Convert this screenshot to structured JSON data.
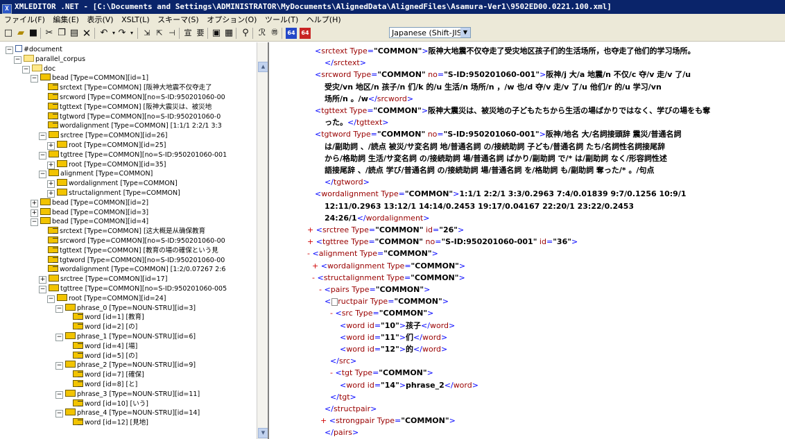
{
  "titlebar": {
    "text": "XMLEDITOR .NET - [C:\\Documents and Settings\\ADMINISTRATOR\\MyDocuments\\AlignedData\\AlignedFiles\\Asamura-Ver1\\9502ED00.0221.100.xml]"
  },
  "menu": [
    "ファイル(F)",
    "編集(E)",
    "表示(V)",
    "XSLT(L)",
    "スキーマ(S)",
    "オプション(O)",
    "ツール(T)",
    "ヘルプ(H)"
  ],
  "toolbar": {
    "encoding": "Japanese (Shift-JIS"
  },
  "tree": [
    {
      "label": "#document",
      "icon": "doc",
      "exp": "−"
    },
    {
      "label": "parallel_corpus",
      "icon": "fd",
      "exp": "−"
    },
    {
      "label": "doc",
      "icon": "fd",
      "exp": "−"
    },
    {
      "label": "bead [Type=COMMON][id=1]",
      "icon": "el",
      "exp": "−"
    },
    {
      "label": "srctext [Type=COMMON] [阪神大地震不仅夺走了",
      "icon": "tx",
      "exp": ""
    },
    {
      "label": "srcword [Type=COMMON][no=S-ID:950201060-00",
      "icon": "tx",
      "exp": ""
    },
    {
      "label": "tgttext [Type=COMMON] [阪神大震災は、被災地",
      "icon": "tx",
      "exp": ""
    },
    {
      "label": "tgtword [Type=COMMON][no=S-ID:950201060-0",
      "icon": "tx",
      "exp": ""
    },
    {
      "label": "wordalignment [Type=COMMON] [1:1/1 2:2/1 3:3",
      "icon": "tx",
      "exp": ""
    },
    {
      "label": "srctree [Type=COMMON][id=26]",
      "icon": "el",
      "exp": "−"
    },
    {
      "label": "root [Type=COMMON][id=25]",
      "icon": "el",
      "exp": "+"
    },
    {
      "label": "tgttree [Type=COMMON][no=S-ID:950201060-001",
      "icon": "el",
      "exp": "−"
    },
    {
      "label": "root [Type=COMMON][id=35]",
      "icon": "el",
      "exp": "+"
    },
    {
      "label": "alignment [Type=COMMON]",
      "icon": "el",
      "exp": "−"
    },
    {
      "label": "wordalignment [Type=COMMON]",
      "icon": "el",
      "exp": "+"
    },
    {
      "label": "structalignment [Type=COMMON]",
      "icon": "el",
      "exp": "+"
    },
    {
      "label": "bead [Type=COMMON][id=2]",
      "icon": "el",
      "exp": "+"
    },
    {
      "label": "bead [Type=COMMON][id=3]",
      "icon": "el",
      "exp": "+"
    },
    {
      "label": "bead [Type=COMMON][id=4]",
      "icon": "el",
      "exp": "−"
    },
    {
      "label": "srctext [Type=COMMON] [这大概是从确保教育",
      "icon": "tx",
      "exp": ""
    },
    {
      "label": "srcword [Type=COMMON][no=S-ID:950201060-00",
      "icon": "tx",
      "exp": ""
    },
    {
      "label": "tgttext [Type=COMMON] [教育の場の確保という見",
      "icon": "tx",
      "exp": ""
    },
    {
      "label": "tgtword [Type=COMMON][no=S-ID:950201060-00",
      "icon": "tx",
      "exp": ""
    },
    {
      "label": "wordalignment [Type=COMMON] [1:2/0.07267 2:6",
      "icon": "tx",
      "exp": ""
    },
    {
      "label": "srctree [Type=COMMON][id=17]",
      "icon": "el",
      "exp": "+"
    },
    {
      "label": "tgttree [Type=COMMON][no=S-ID:950201060-005",
      "icon": "el",
      "exp": "−"
    },
    {
      "label": "root [Type=COMMON][id=24]",
      "icon": "el",
      "exp": "−"
    },
    {
      "label": "phrase_0 [Type=NOUN-STRU][id=3]",
      "icon": "el",
      "exp": "−"
    },
    {
      "label": "word [id=1] [教育]",
      "icon": "tx",
      "exp": ""
    },
    {
      "label": "word [id=2] [の]",
      "icon": "tx",
      "exp": ""
    },
    {
      "label": "phrase_1 [Type=NOUN-STRU][id=6]",
      "icon": "el",
      "exp": "−"
    },
    {
      "label": "word [id=4] [場]",
      "icon": "tx",
      "exp": ""
    },
    {
      "label": "word [id=5] [の]",
      "icon": "tx",
      "exp": ""
    },
    {
      "label": "phrase_2 [Type=NOUN-STRU][id=9]",
      "icon": "el",
      "exp": "−"
    },
    {
      "label": "word [id=7] [確保]",
      "icon": "tx",
      "exp": ""
    },
    {
      "label": "word [id=8] [と]",
      "icon": "tx",
      "exp": ""
    },
    {
      "label": "phrase_3 [Type=NOUN-STRU][id=11]",
      "icon": "el",
      "exp": "−"
    },
    {
      "label": "word [id=10] [いう]",
      "icon": "tx",
      "exp": ""
    },
    {
      "label": "phrase_4 [Type=NOUN-STRU][id=14]",
      "icon": "el",
      "exp": "−"
    },
    {
      "label": "word [id=12] [見地]",
      "icon": "tx",
      "exp": ""
    }
  ],
  "xml": [
    "<srctext Type=\"COMMON\">阪神大地震不仅夺走了受灾地区孩子们的生活场所，也夺走了他们的学习场所。",
    "</srctext>",
    "<srcword Type=\"COMMON\" no=\"S-ID:950201060-001\">阪神/j 大/a 地震/n 不仅/c 夺/v 走/v 了/u",
    "受灾/vn 地区/n 孩子/n 们/k 的/u 生活/n 场所/n ，/w 也/d 夺/v 走/v 了/u 他们/r 的/u 学习/vn",
    "场所/n 。/w</srcword>",
    "<tgttext Type=\"COMMON\">阪神大震災は、被災地の子どもたちから生活の場ばかりではなく、学びの場をも奪",
    "った。</tgttext>",
    "<tgtword Type=\"COMMON\" no=\"S-ID:950201060-001\">阪神/地名 大/名詞接頭辞 震災/普通名詞",
    "は/副助詞 、/読点 被災/サ変名詞 地/普通名詞 の/接続助詞 子ども/普通名詞 たち/名詞性名詞接尾辞",
    "から/格助詞 生活/サ変名詞 の/接続助詞 場/普通名詞 ばかり/副助詞 で/* は/副助詞 なく/形容詞性述",
    "語接尾辞 、/読点 学び/普通名詞 の/接続助詞 場/普通名詞 を/格助詞 も/副助詞 奪った/* 。/句点",
    "</tgtword>",
    "<wordalignment Type=\"COMMON\">1:1/1 2:2/1 3:3/0.2963 7:4/0.01839 9:7/0.1256 10:9/1",
    "12:11/0.2963 13:12/1 14:14/0.2453 19:17/0.04167 22:20/1 23:22/0.2453",
    "24:26/1</wordalignment>",
    "+ <srctree Type=\"COMMON\" id=\"26\">",
    "+ <tgttree Type=\"COMMON\" no=\"S-ID:950201060-001\" id=\"36\">",
    "- <alignment Type=\"COMMON\">",
    "+ <wordalignment Type=\"COMMON\">",
    "- <structalignment Type=\"COMMON\">",
    "- <pairs Type=\"COMMON\">",
    "<structpair Type=\"COMMON\">",
    "- <src Type=\"COMMON\">",
    "<word id=\"10\">孩子</word>",
    "<word id=\"11\">们</word>",
    "<word id=\"12\">的</word>",
    "</src>",
    "- <tgt Type=\"COMMON\">",
    "<word id=\"14\">phrase_2</word>",
    "</tgt>",
    "</structpair>",
    "+ <strongpair Type=\"COMMON\">",
    "</pairs>"
  ]
}
